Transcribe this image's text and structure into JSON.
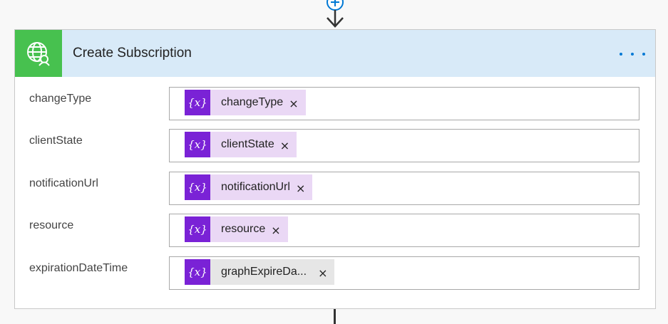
{
  "card": {
    "title": "Create Subscription",
    "icon": "globe-user-icon",
    "menu_icon": "more-options-icon"
  },
  "fields": [
    {
      "label": "changeType",
      "token": "changeType",
      "token_icon": "{x}",
      "remove": "×",
      "token_style": "variable"
    },
    {
      "label": "clientState",
      "token": "clientState",
      "token_icon": "{x}",
      "remove": "×",
      "token_style": "variable"
    },
    {
      "label": "notificationUrl",
      "token": "notificationUrl",
      "token_icon": "{x}",
      "remove": "×",
      "token_style": "variable"
    },
    {
      "label": "resource",
      "token": "resource",
      "token_icon": "{x}",
      "remove": "×",
      "token_style": "variable"
    },
    {
      "label": "expirationDateTime",
      "token": "graphExpireDa...",
      "token_icon": "{x}",
      "remove": "×",
      "token_style": "variable-hovered"
    }
  ],
  "colors": {
    "header_bg": "#d8eaf8",
    "icon_bg": "#47c14f",
    "token_icon_bg": "#7a22d6",
    "token_bg": "#ead8f5",
    "accent": "#0078d4"
  }
}
